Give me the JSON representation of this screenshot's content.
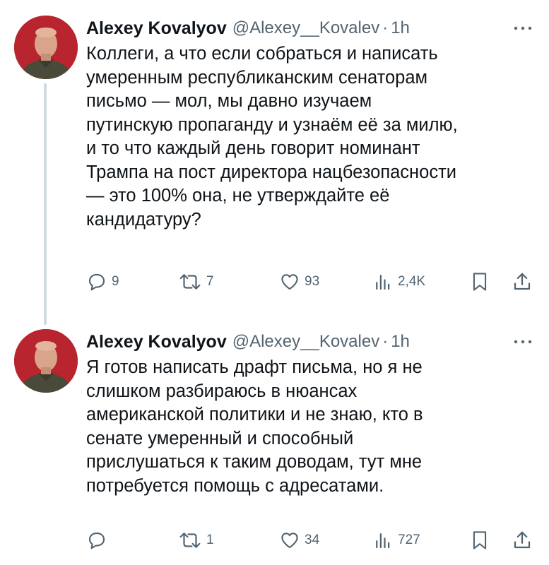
{
  "tweets": [
    {
      "author_name": "Alexey Kovalyov",
      "handle": "@Alexey__Kovalev",
      "separator": "·",
      "time": "1h",
      "avatar_icon": "avatar-photo",
      "more_icon": "more-dots-icon",
      "text": "Коллеги, а что если собраться и написать\nумеренным республиканским сенаторам\nписьмо — мол, мы давно изучаем\nпутинскую пропаганду и узнаём её за милю,\nи то что каждый день говорит номинант\nТрампа на пост директора нацбезопасности\n— это 100% она, не утверждайте её\nкандидатуру?",
      "replies": "9",
      "reposts": "7",
      "likes": "93",
      "views": "2,4K"
    },
    {
      "author_name": "Alexey Kovalyov",
      "handle": "@Alexey__Kovalev",
      "separator": "·",
      "time": "1h",
      "avatar_icon": "avatar-photo",
      "more_icon": "more-dots-icon",
      "text": "Я готов написать драфт письма, но я не\nслишком разбираюсь в нюансах\nамериканской политики и не знаю, кто в\nсенате умеренный и способный\nприслушаться к таким доводам, тут мне\nпотребуется помощь с адресатами.",
      "replies": "",
      "reposts": "1",
      "likes": "34",
      "views": "727"
    }
  ],
  "colors": {
    "text": "#0f1419",
    "secondary": "#536471",
    "thread_line": "#cfd9de",
    "avatar_bg": "#b8252e"
  }
}
